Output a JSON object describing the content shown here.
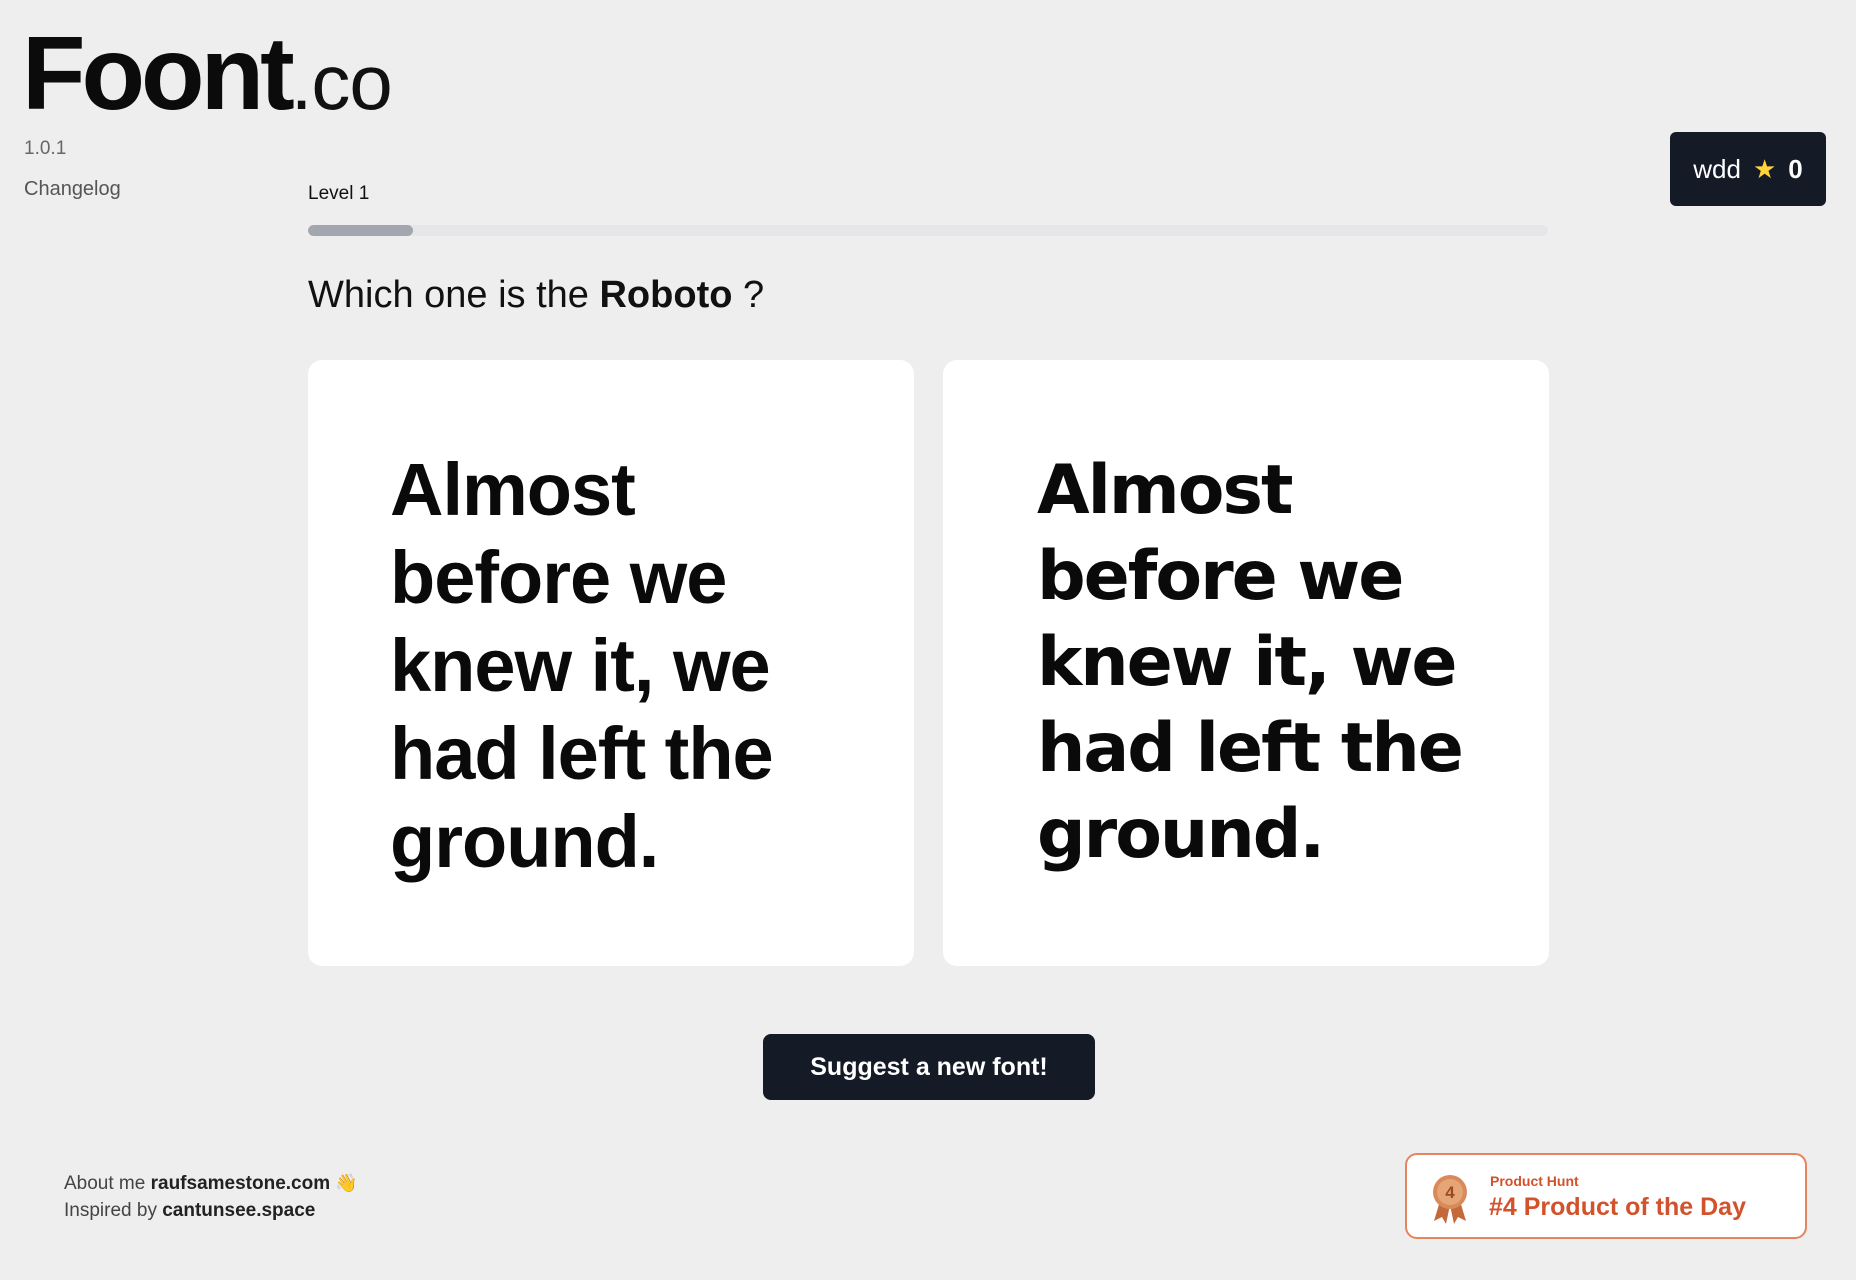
{
  "brand": {
    "name": "Foont",
    "tld": ".co",
    "version": "1.0.1",
    "changelog_label": "Changelog"
  },
  "user": {
    "name": "wdd",
    "star_icon": "star-icon",
    "score": "0",
    "star_color": "#ffd43b"
  },
  "game": {
    "level_label": "Level 1",
    "progress_fraction": 0.085,
    "question_prefix": "Which one is the",
    "font_name": "Roboto",
    "question_suffix": "?",
    "options": [
      {
        "sample_text": "Almost before we knew it, we had left the ground."
      },
      {
        "sample_text": "Almost before we knew it, we had left the ground."
      }
    ],
    "suggest_button_label": "Suggest a new font!"
  },
  "footer": {
    "about_prefix": "About me",
    "about_link": "raufsamestone.com",
    "about_emoji": "👋",
    "inspired_prefix": "Inspired by",
    "inspired_link": "cantunsee.space"
  },
  "product_hunt": {
    "label": "Product Hunt",
    "rank_text": "#4 Product of the Day",
    "medal_number": "4",
    "accent_color": "#d2522b"
  },
  "colors": {
    "background": "#eeeeef",
    "dark_button": "#151a27",
    "card": "#ffffff"
  }
}
